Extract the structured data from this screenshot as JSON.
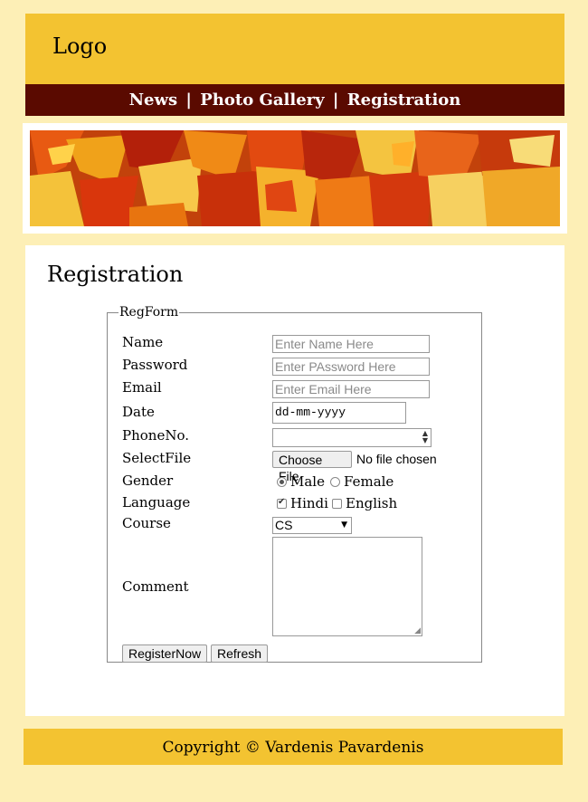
{
  "header": {
    "logo": "Logo"
  },
  "nav": {
    "items": [
      {
        "label": "News"
      },
      {
        "label": "Photo Gallery"
      },
      {
        "label": "Registration"
      }
    ],
    "separator": "|"
  },
  "banner": {
    "image": "autumn-leaves-image"
  },
  "main": {
    "title": "Registration",
    "form": {
      "legend": "RegForm",
      "name": {
        "label": "Name",
        "placeholder": "Enter Name Here"
      },
      "password": {
        "label": "Password",
        "placeholder": "Enter PAssword Here"
      },
      "email": {
        "label": "Email",
        "placeholder": "Enter Email Here"
      },
      "date": {
        "label": "Date",
        "placeholder": "dd-mm-yyyy"
      },
      "phone": {
        "label": "PhoneNo."
      },
      "file": {
        "label": "SelectFile",
        "button": "Choose File",
        "status": "No file chosen"
      },
      "gender": {
        "label": "Gender",
        "options": [
          {
            "label": "Male",
            "selected": true
          },
          {
            "label": "Female",
            "selected": false
          }
        ]
      },
      "language": {
        "label": "Language",
        "options": [
          {
            "label": "Hindi",
            "checked": true
          },
          {
            "label": "English",
            "checked": false
          }
        ]
      },
      "course": {
        "label": "Course",
        "selected": "CS"
      },
      "comment": {
        "label": "Comment"
      },
      "buttons": {
        "register": "RegisterNow",
        "refresh": "Refresh"
      }
    }
  },
  "footer": {
    "text": "Copyright © Vardenis Pavardenis"
  },
  "colors": {
    "page_bg": "#fdefb6",
    "header_bg": "#f3c331",
    "nav_bg": "#5a0a00",
    "footer_bg": "#f3c331"
  }
}
